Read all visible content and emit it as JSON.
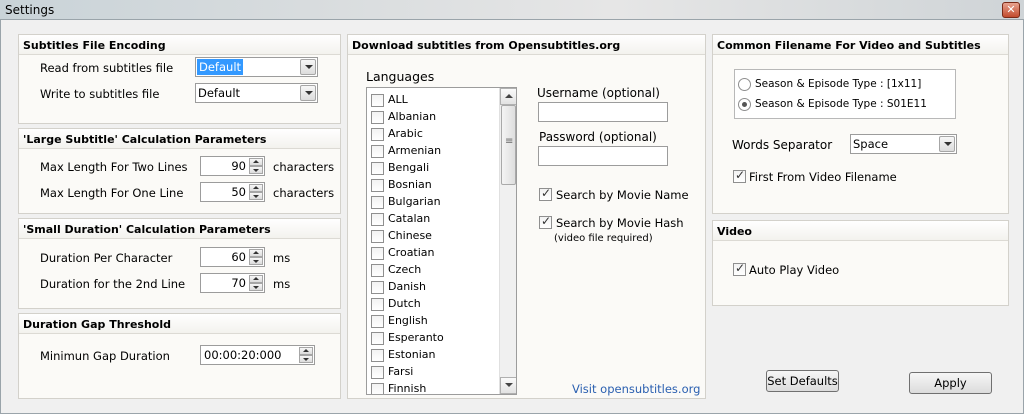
{
  "window": {
    "title": "Settings"
  },
  "encoding": {
    "title": "Subtitles File Encoding",
    "read_label": "Read from subtitles file",
    "read_value": "Default",
    "write_label": "Write to subtitles file",
    "write_value": "Default"
  },
  "large": {
    "title": "'Large Subtitle' Calculation Parameters",
    "two_lines_label": "Max Length For Two Lines",
    "two_lines_value": "90",
    "one_line_label": "Max Length For One Line",
    "one_line_value": "50",
    "unit": "characters"
  },
  "small": {
    "title": "'Small Duration' Calculation Parameters",
    "per_char_label": "Duration Per Character",
    "per_char_value": "60",
    "second_line_label": "Duration for the 2nd Line",
    "second_line_value": "70",
    "unit": "ms"
  },
  "gap": {
    "title": "Duration Gap Threshold",
    "min_label": "Minimun Gap Duration",
    "min_value": "00:00:20:000"
  },
  "download": {
    "title": "Download subtitles from Opensubtitles.org",
    "languages_label": "Languages",
    "languages": [
      "ALL",
      "Albanian",
      "Arabic",
      "Armenian",
      "Bengali",
      "Bosnian",
      "Bulgarian",
      "Catalan",
      "Chinese",
      "Croatian",
      "Czech",
      "Danish",
      "Dutch",
      "English",
      "Esperanto",
      "Estonian",
      "Farsi",
      "Finnish"
    ],
    "username_label": "Username (optional)",
    "password_label": "Password (optional)",
    "search_name_label": "Search by Movie Name",
    "search_hash_label": "Search by Movie Hash",
    "hash_note": "(video file required)",
    "visit_link": "Visit opensubtitles.org"
  },
  "filename": {
    "title": "Common Filename For Video and Subtitles",
    "option1": "Season & Episode Type : [1x11]",
    "option2": "Season & Episode Type : S01E11",
    "separator_label": "Words Separator",
    "separator_value": "Space",
    "first_from_video_label": "First From Video Filename"
  },
  "video": {
    "title": "Video",
    "autoplay_label": "Auto Play Video"
  },
  "buttons": {
    "set_defaults": "Set Defaults",
    "apply": "Apply"
  }
}
